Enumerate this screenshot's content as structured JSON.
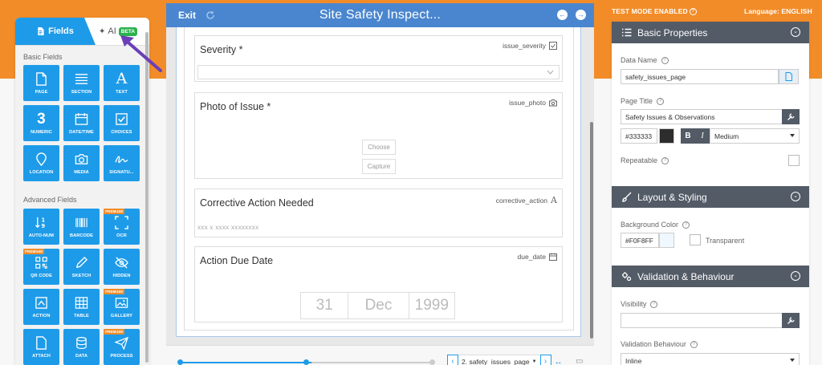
{
  "header": {
    "test_mode": "TEST MODE ENABLED",
    "language": "Language: ENGLISH"
  },
  "left_panel": {
    "tab_fields": "Fields",
    "tab_ai": "AI",
    "tab_ai_badge": "BETA",
    "basic_title": "Basic Fields",
    "advanced_title": "Advanced Fields",
    "premium_label": "PREMIUM",
    "basic_fields": [
      "PAGE",
      "SECTION",
      "TEXT",
      "NUMERIC",
      "DATE/TIME",
      "CHOICES",
      "LOCATION",
      "MEDIA",
      "SIGNATU..."
    ],
    "advanced_fields": [
      "AUTO-NUM",
      "BARCODE",
      "OCR",
      "QR CODE",
      "SKETCH",
      "HIDDEN",
      "ACTION",
      "TABLE",
      "GALLERY",
      "ATTACH",
      "DATA",
      "PROCESS"
    ],
    "numeric_glyph": "3",
    "text_glyph": "A"
  },
  "canvas": {
    "exit": "Exit",
    "title": "Site Safety Inspect...",
    "fields": [
      {
        "label": "Severity *",
        "key": "issue_severity"
      },
      {
        "label": "Photo of Issue *",
        "key": "issue_photo",
        "buttons": [
          "Choose",
          "Capture"
        ]
      },
      {
        "label": "Corrective Action Needed",
        "key": "corrective_action",
        "placeholder": "xxx x xxxx xxxxxxxx"
      },
      {
        "label": "Action Due Date",
        "key": "due_date",
        "date": [
          "31",
          "Dec",
          "1999"
        ]
      }
    ],
    "page_select": "2. safety_issues_page"
  },
  "right_panel": {
    "basic_properties": "Basic Properties",
    "data_name_label": "Data Name",
    "data_name_value": "safety_issues_page",
    "page_title_label": "Page Title",
    "page_title_value": "Safety Issues & Observations",
    "color_value": "#333333",
    "bold": "B",
    "italic": "I",
    "weight_value": "Medium",
    "repeatable_label": "Repeatable",
    "layout_styling": "Layout & Styling",
    "background_color_label": "Background Color",
    "background_color_value": "#F0F8FF",
    "transparent_label": "Transparent",
    "validation_behaviour": "Validation & Behaviour",
    "visibility_label": "Visibility",
    "visibility_value": "",
    "validation_behaviour_label": "Validation Behaviour",
    "validation_behaviour_value": "Inline"
  },
  "colors": {
    "accent_orange": "#f28c28",
    "primary_blue": "#1e9be8",
    "header_blue": "#4a86cf",
    "panel_dark": "#525b66",
    "beta_green": "#2bb24c",
    "text_color_swatch": "#333333",
    "bg_color_swatch": "#F0F8FF"
  }
}
